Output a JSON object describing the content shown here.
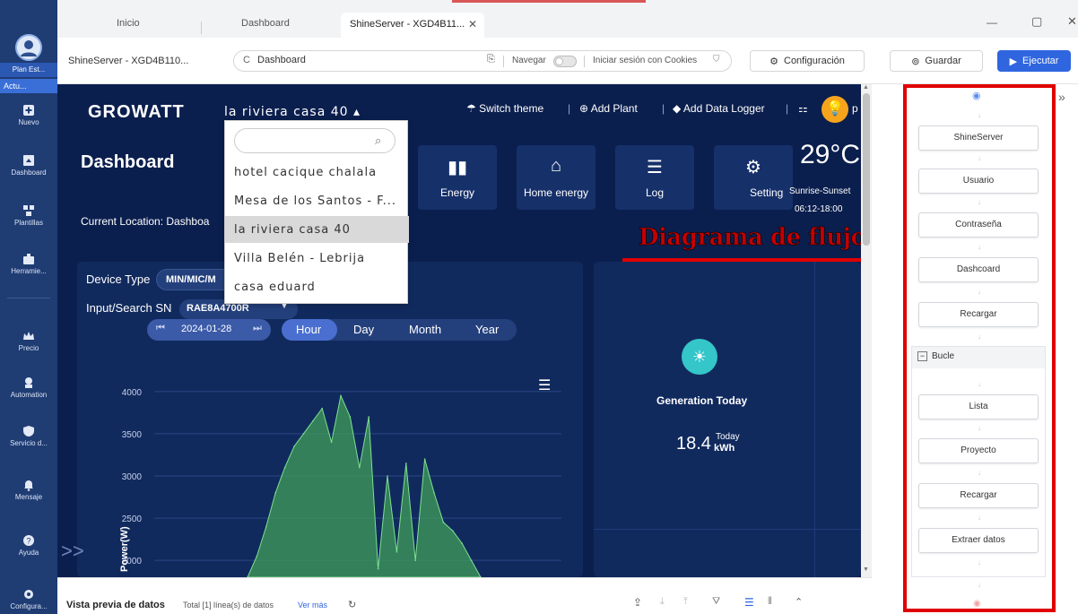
{
  "rail": {
    "user": "Plan Est...",
    "active": "Actu...",
    "items": [
      "Nuevo",
      "Dashboard",
      "Plantillas",
      "Herramie...",
      "Precio",
      "Automation",
      "Servicio d...",
      "Mensaje",
      "Ayuda",
      "Configura..."
    ]
  },
  "tabs": {
    "t1": "Inicio",
    "t2": "Dashboard",
    "t3": "ShineServer - XGD4B11...",
    "close": "✕"
  },
  "window": {
    "min": "—",
    "max": "▢",
    "close": "✕"
  },
  "addr": {
    "title": "ShineServer - XGD4B110...",
    "url": "Dashboard",
    "navegar": "Navegar",
    "cookies": "Iniciar sesión con Cookies",
    "config": "Configuración",
    "guardar": "Guardar",
    "ejecutar": "Ejecutar"
  },
  "site": {
    "logo": "GROWATT",
    "plant": "la riviera casa 40",
    "switch_theme": "Switch theme",
    "add_plant": "Add Plant",
    "add_logger": "Add Data Logger",
    "heading": "Dashboard",
    "location": "Current Location: Dashboa",
    "tiles": [
      "Energy",
      "Home energy",
      "Log",
      "Setting"
    ],
    "temp": "29°C",
    "sunrise_label": "Sunrise-Sunset",
    "sunrise_value": "06:12-18:00",
    "dropdown": [
      "hotel cacique chalala",
      "Mesa de los Santos - F...",
      "la riviera casa 40",
      "Villa Belén - Lebrija",
      "casa eduard"
    ],
    "device_type_label": "Device Type",
    "device_type_value": "MIN/MIC/M",
    "sn_label": "Input/Search SN",
    "sn_value": "RAE8A4700R",
    "date": "2024-01-28",
    "periods": [
      "Hour",
      "Day",
      "Month",
      "Year"
    ],
    "gen_title": "Generation Today",
    "gen_value": "18.4",
    "gen_unit_top": "Today",
    "gen_unit": "kWh"
  },
  "annotation": "Diagrama de flujo",
  "flow": {
    "nodes": [
      "ShineServer",
      "Usuario",
      "Contraseña",
      "Dashcoard",
      "Recargar"
    ],
    "loop_label": "Bucle",
    "loop_nodes": [
      "Lista",
      "Proyecto",
      "Recargar",
      "Extraer datos"
    ]
  },
  "bottom": {
    "title": "Vista previa de datos",
    "total": "Total [1] línea(s) de datos",
    "more": "Ver más"
  },
  "chart_data": {
    "type": "area",
    "ylabel": "Power(W)",
    "yticks": [
      4000,
      3500,
      3000,
      2500,
      2000
    ],
    "ylim": [
      1800,
      4200
    ],
    "color": "#3f9e5a",
    "x": [
      0,
      4,
      8,
      12,
      16,
      20,
      24,
      28,
      32,
      36,
      40,
      44,
      48,
      52,
      56,
      60,
      64,
      68,
      72,
      76,
      80,
      84,
      88,
      92,
      96,
      100
    ],
    "y": [
      1800,
      2050,
      2400,
      2800,
      3100,
      3350,
      3500,
      3650,
      3800,
      3400,
      3950,
      3700,
      3100,
      3700,
      1900,
      3000,
      2100,
      3150,
      2000,
      3200,
      2800,
      2450,
      2350,
      2200,
      2000,
      1800
    ]
  }
}
